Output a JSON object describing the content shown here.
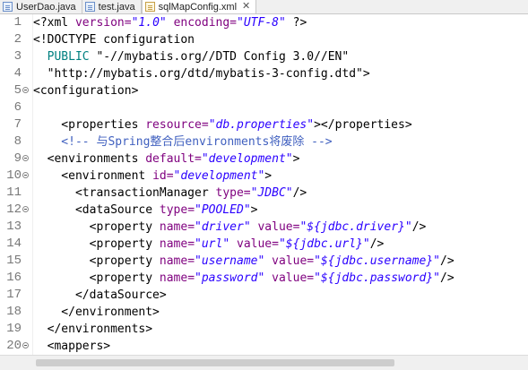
{
  "tabs": [
    {
      "label": "UserDao.java",
      "icon": "java-file-icon",
      "active": false
    },
    {
      "label": "test.java",
      "icon": "java-file-icon",
      "active": false
    },
    {
      "label": "sqlMapConfig.xml",
      "icon": "xml-file-icon",
      "active": true,
      "close": "✕"
    }
  ],
  "editor": {
    "lines": [
      {
        "n": "1",
        "fold": false,
        "tokens": [
          {
            "t": "<?xml ",
            "c": "t"
          },
          {
            "t": "version=",
            "c": "a"
          },
          {
            "t": "\"1.0\"",
            "c": "v"
          },
          {
            "t": " ",
            "c": "t"
          },
          {
            "t": "encoding=",
            "c": "a"
          },
          {
            "t": "\"UTF-8\"",
            "c": "v"
          },
          {
            "t": " ?>",
            "c": "t"
          }
        ]
      },
      {
        "n": "2",
        "fold": false,
        "tokens": [
          {
            "t": "<!DOCTYPE configuration",
            "c": "t"
          }
        ]
      },
      {
        "n": "3",
        "fold": false,
        "tokens": [
          {
            "t": "  ",
            "c": "t"
          },
          {
            "t": "PUBLIC",
            "c": "d"
          },
          {
            "t": " \"-//mybatis.org//DTD Config 3.0//EN\"",
            "c": "t"
          }
        ]
      },
      {
        "n": "4",
        "fold": false,
        "tokens": [
          {
            "t": "  \"http://mybatis.org/dtd/mybatis-3-config.dtd\">",
            "c": "t"
          }
        ]
      },
      {
        "n": "5",
        "fold": true,
        "tokens": [
          {
            "t": "<configuration>",
            "c": "t"
          }
        ]
      },
      {
        "n": "6",
        "fold": false,
        "tokens": []
      },
      {
        "n": "7",
        "fold": false,
        "tokens": [
          {
            "t": "    <properties ",
            "c": "t"
          },
          {
            "t": "resource=",
            "c": "a"
          },
          {
            "t": "\"db.properties\"",
            "c": "v"
          },
          {
            "t": "></properties>",
            "c": "t"
          }
        ]
      },
      {
        "n": "8",
        "fold": false,
        "tokens": [
          {
            "t": "    <!-- 与Spring整合后environments将废除 -->",
            "c": "c"
          }
        ]
      },
      {
        "n": "9",
        "fold": true,
        "tokens": [
          {
            "t": "  <environments ",
            "c": "t"
          },
          {
            "t": "default=",
            "c": "a"
          },
          {
            "t": "\"development\"",
            "c": "v"
          },
          {
            "t": ">",
            "c": "t"
          }
        ]
      },
      {
        "n": "10",
        "fold": true,
        "tokens": [
          {
            "t": "    <environment ",
            "c": "t"
          },
          {
            "t": "id=",
            "c": "a"
          },
          {
            "t": "\"development\"",
            "c": "v"
          },
          {
            "t": ">",
            "c": "t"
          }
        ]
      },
      {
        "n": "11",
        "fold": false,
        "tokens": [
          {
            "t": "      <transactionManager ",
            "c": "t"
          },
          {
            "t": "type=",
            "c": "a"
          },
          {
            "t": "\"JDBC\"",
            "c": "v"
          },
          {
            "t": "/>",
            "c": "t"
          }
        ]
      },
      {
        "n": "12",
        "fold": true,
        "tokens": [
          {
            "t": "      <dataSource ",
            "c": "t"
          },
          {
            "t": "type=",
            "c": "a"
          },
          {
            "t": "\"POOLED\"",
            "c": "v"
          },
          {
            "t": ">",
            "c": "t"
          }
        ]
      },
      {
        "n": "13",
        "fold": false,
        "tokens": [
          {
            "t": "        <property ",
            "c": "t"
          },
          {
            "t": "name=",
            "c": "a"
          },
          {
            "t": "\"driver\"",
            "c": "v"
          },
          {
            "t": " ",
            "c": "t"
          },
          {
            "t": "value=",
            "c": "a"
          },
          {
            "t": "\"${jdbc.driver}\"",
            "c": "v"
          },
          {
            "t": "/>",
            "c": "t"
          }
        ]
      },
      {
        "n": "14",
        "fold": false,
        "tokens": [
          {
            "t": "        <property ",
            "c": "t"
          },
          {
            "t": "name=",
            "c": "a"
          },
          {
            "t": "\"url\"",
            "c": "v"
          },
          {
            "t": " ",
            "c": "t"
          },
          {
            "t": "value=",
            "c": "a"
          },
          {
            "t": "\"${jdbc.url}\"",
            "c": "v"
          },
          {
            "t": "/>",
            "c": "t"
          }
        ]
      },
      {
        "n": "15",
        "fold": false,
        "tokens": [
          {
            "t": "        <property ",
            "c": "t"
          },
          {
            "t": "name=",
            "c": "a"
          },
          {
            "t": "\"username\"",
            "c": "v"
          },
          {
            "t": " ",
            "c": "t"
          },
          {
            "t": "value=",
            "c": "a"
          },
          {
            "t": "\"${jdbc.username}\"",
            "c": "v"
          },
          {
            "t": "/>",
            "c": "t"
          }
        ]
      },
      {
        "n": "16",
        "fold": false,
        "tokens": [
          {
            "t": "        <property ",
            "c": "t"
          },
          {
            "t": "name=",
            "c": "a"
          },
          {
            "t": "\"password\"",
            "c": "v"
          },
          {
            "t": " ",
            "c": "t"
          },
          {
            "t": "value=",
            "c": "a"
          },
          {
            "t": "\"${jdbc.password}\"",
            "c": "v"
          },
          {
            "t": "/>",
            "c": "t"
          }
        ]
      },
      {
        "n": "17",
        "fold": false,
        "tokens": [
          {
            "t": "      </dataSource>",
            "c": "t"
          }
        ]
      },
      {
        "n": "18",
        "fold": false,
        "tokens": [
          {
            "t": "    </environment>",
            "c": "t"
          }
        ]
      },
      {
        "n": "19",
        "fold": false,
        "tokens": [
          {
            "t": "  </environments>",
            "c": "t"
          }
        ]
      },
      {
        "n": "20",
        "fold": true,
        "tokens": [
          {
            "t": "  <mappers>",
            "c": "t"
          }
        ]
      }
    ]
  },
  "colors": {
    "tag": "#000000",
    "attribute": "#7f007f",
    "value": "#2a00ff",
    "doctype_keyword": "#008080",
    "comment": "#3f5fbf",
    "line_number": "#787878"
  }
}
